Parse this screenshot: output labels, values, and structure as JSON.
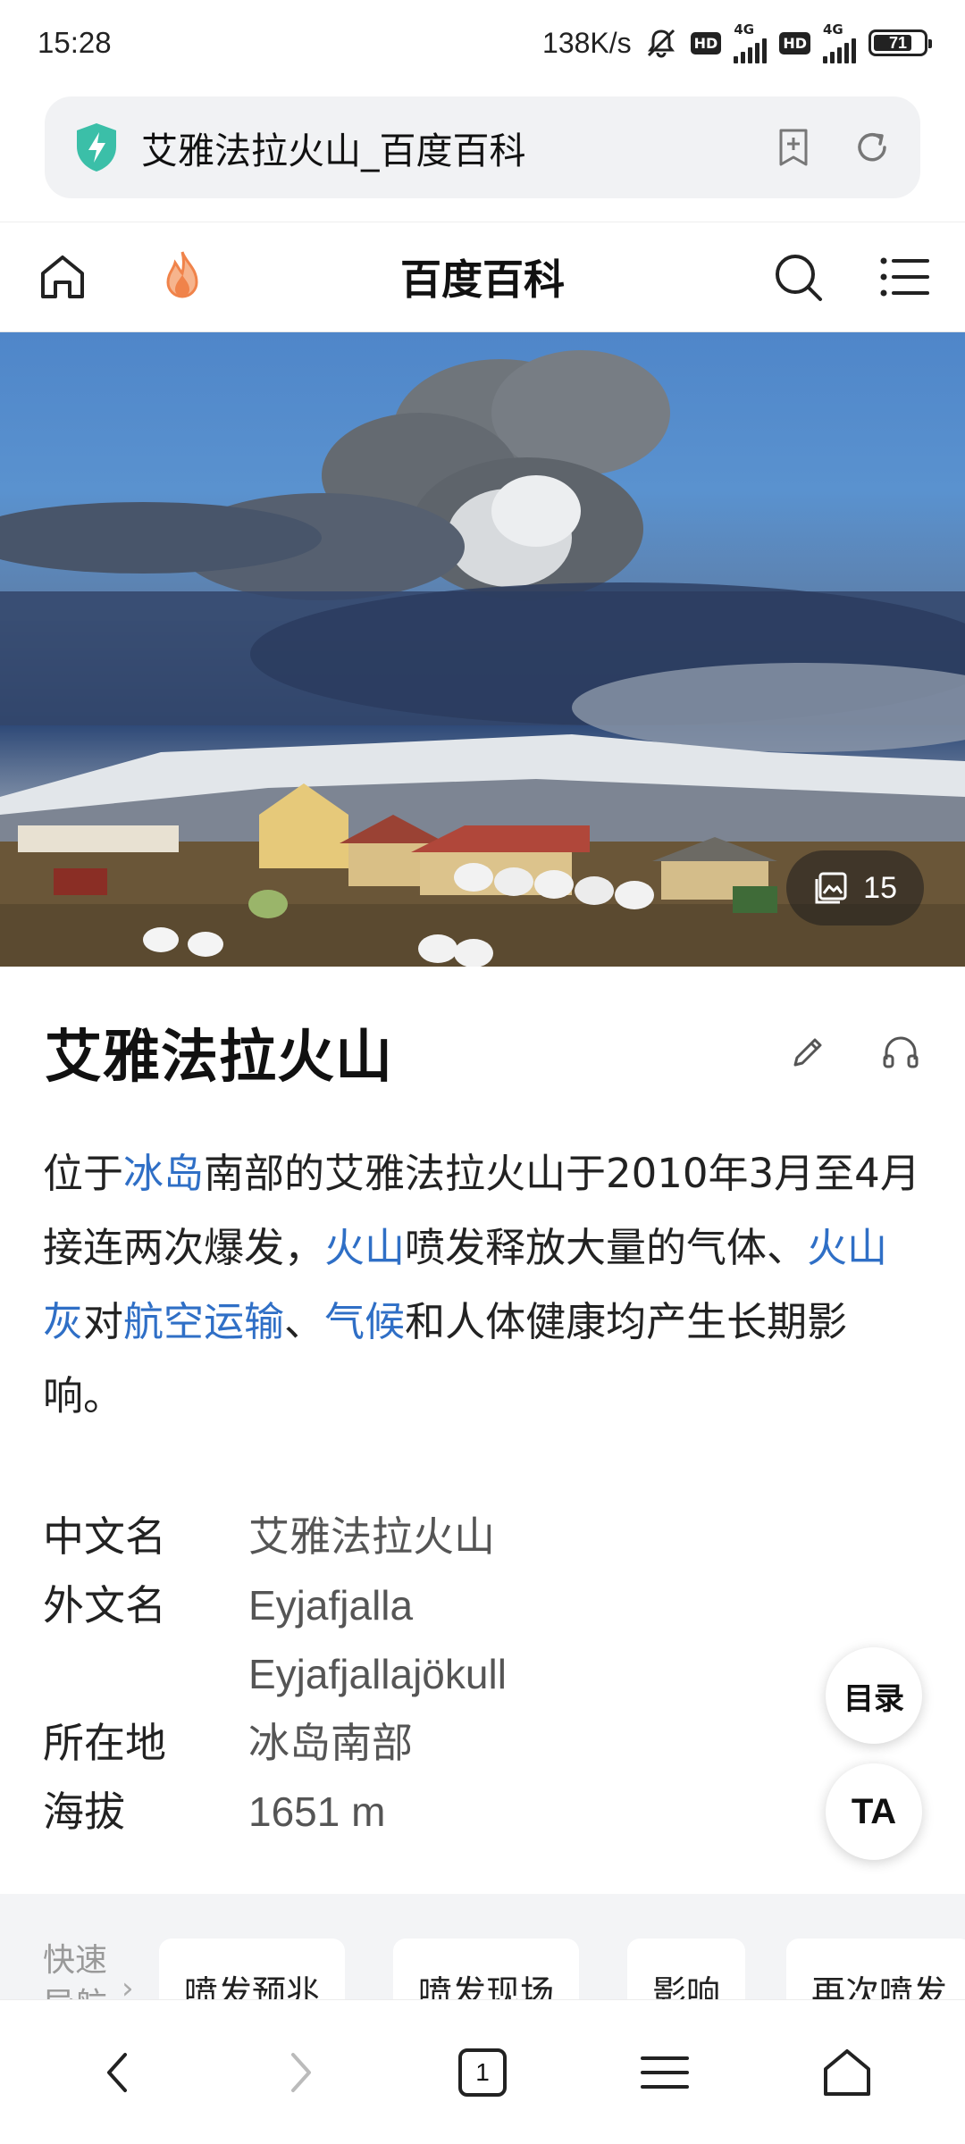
{
  "status_bar": {
    "time": "15:28",
    "net_speed": "138K/s",
    "battery": "71",
    "network_1": "4G",
    "network_2": "4G",
    "hd_1": "HD",
    "hd_2": "HD",
    "icons": [
      "mute-bell-icon",
      "signal-icon",
      "battery-icon"
    ]
  },
  "url_bar": {
    "title": "艾雅法拉火山_百度百科",
    "icons": [
      "security-shield-icon",
      "add-bookmark-icon",
      "reload-icon"
    ]
  },
  "site_header": {
    "title": "百度百科",
    "icons": [
      "home-icon",
      "hot-flame-icon",
      "search-icon",
      "menu-icon"
    ]
  },
  "hero": {
    "photo_count": "15"
  },
  "article": {
    "title": "艾雅法拉火山",
    "summary": [
      {
        "text": "位于",
        "link": false
      },
      {
        "text": "冰岛",
        "link": true
      },
      {
        "text": "南部的艾雅法拉火山于2010年3月至4月接连两次爆发，",
        "link": false
      },
      {
        "text": "火山",
        "link": true
      },
      {
        "text": "喷发释放大量的气体、",
        "link": false
      },
      {
        "text": "火山灰",
        "link": true
      },
      {
        "text": "对",
        "link": false
      },
      {
        "text": "航空运输",
        "link": true
      },
      {
        "text": "、",
        "link": false
      },
      {
        "text": "气候",
        "link": true
      },
      {
        "text": "和人体健康均产生长期影响。",
        "link": false
      }
    ],
    "infobox": [
      {
        "key": "中文名",
        "values": [
          "艾雅法拉火山"
        ]
      },
      {
        "key": "外文名",
        "values": [
          "Eyjafjalla",
          "Eyjafjallajökull"
        ]
      },
      {
        "key": "所在地",
        "values": [
          "冰岛南部"
        ]
      },
      {
        "key": "海拔",
        "values": [
          "1651 m"
        ]
      }
    ]
  },
  "fabs": {
    "toc": "目录",
    "text_size": "TA"
  },
  "quick_nav": {
    "label_line1": "快速",
    "label_line2": "导航",
    "chips": [
      "喷发预兆",
      "喷发现场",
      "影响",
      "再次喷发"
    ]
  },
  "bottom_nav": {
    "tab_count": "1",
    "icons": [
      "back-icon",
      "forward-icon",
      "tabs-icon",
      "menu-icon",
      "home-icon"
    ]
  },
  "colors": {
    "link": "#2f6fc6",
    "shield": "#3bbfa8",
    "flame": "#f0834a"
  }
}
